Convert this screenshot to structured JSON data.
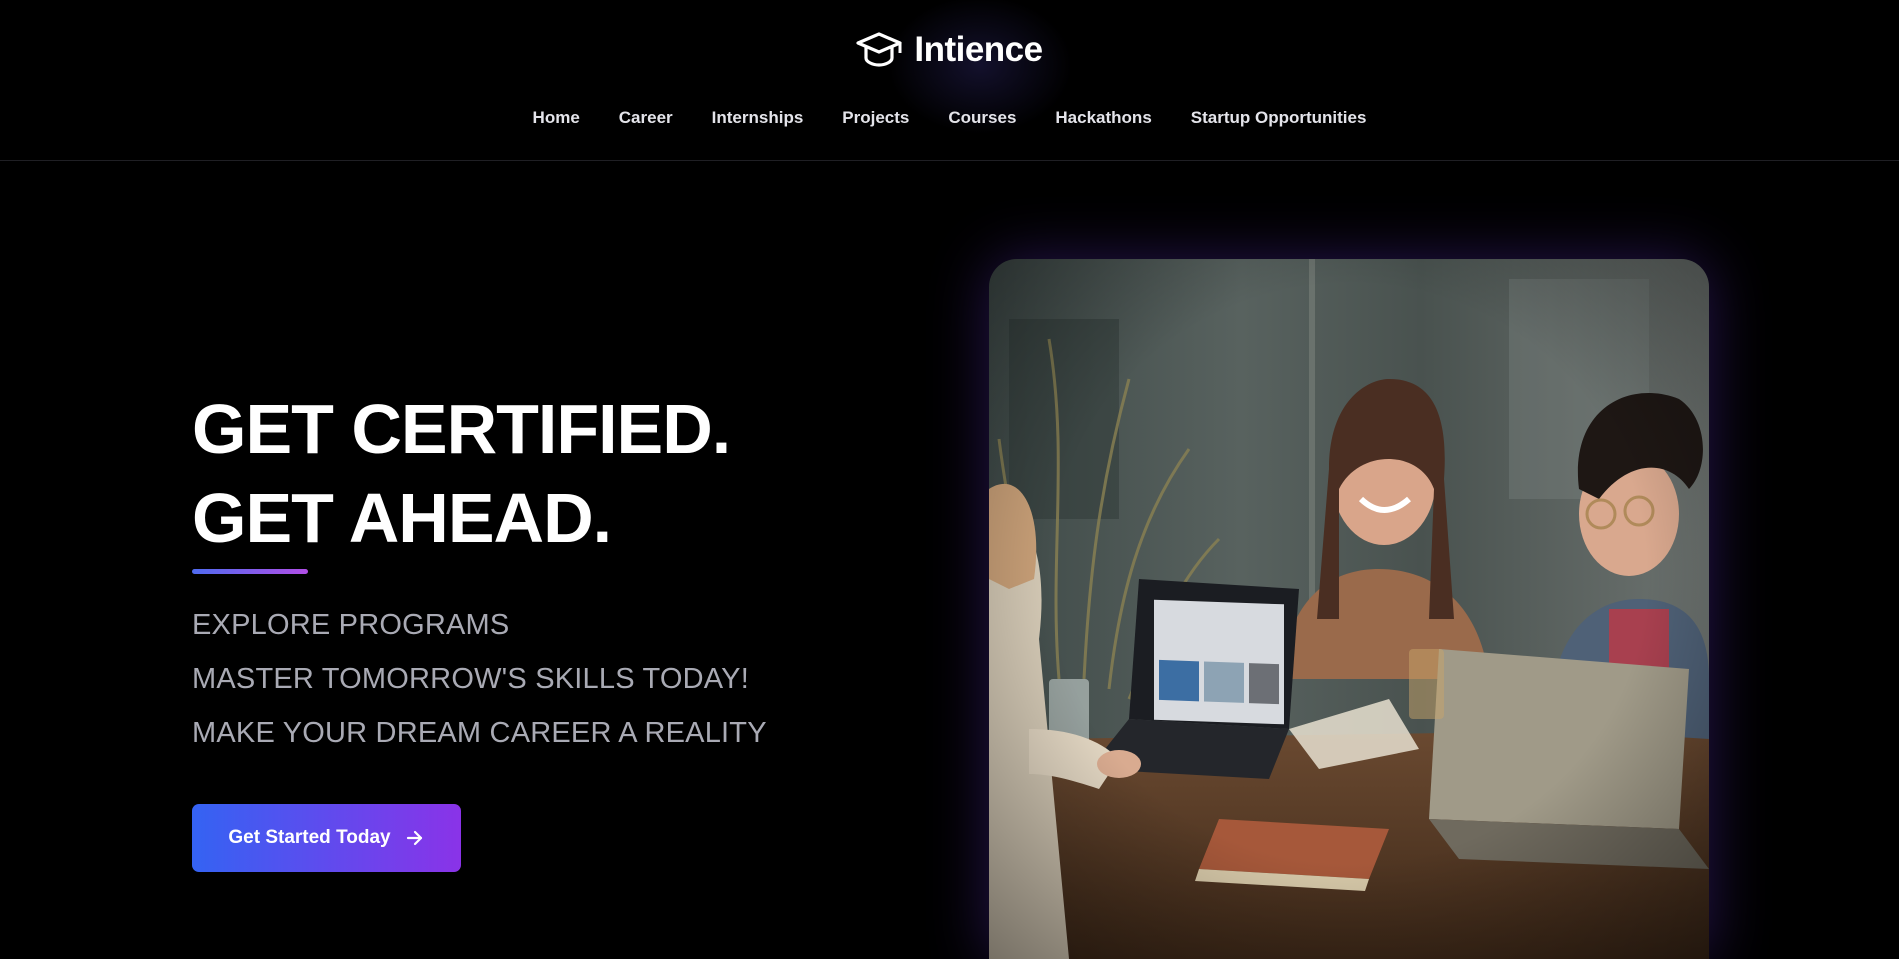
{
  "brand": {
    "name": "Intience",
    "icon": "graduation-cap-icon"
  },
  "nav": {
    "items": [
      {
        "label": "Home"
      },
      {
        "label": "Career"
      },
      {
        "label": "Internships"
      },
      {
        "label": "Projects"
      },
      {
        "label": "Courses"
      },
      {
        "label": "Hackathons"
      },
      {
        "label": "Startup Opportunities"
      }
    ]
  },
  "hero": {
    "headline_line1": "GET CERTIFIED.",
    "headline_line2": "GET AHEAD.",
    "taglines": [
      "EXPLORE PROGRAMS",
      "MASTER TOMORROW'S SKILLS TODAY!",
      "MAKE YOUR DREAM CAREER A REALITY"
    ],
    "cta_label": "Get Started Today",
    "cta_icon": "arrow-right-icon",
    "image_description": "",
    "accent_gradient": [
      "#4f6bf0",
      "#b14ee6"
    ],
    "button_gradient": [
      "#3463f3",
      "#8a33e8"
    ]
  },
  "colors": {
    "background": "#000000",
    "nav_text": "#e4e4ea",
    "tagline_text": "#a9aab4"
  }
}
